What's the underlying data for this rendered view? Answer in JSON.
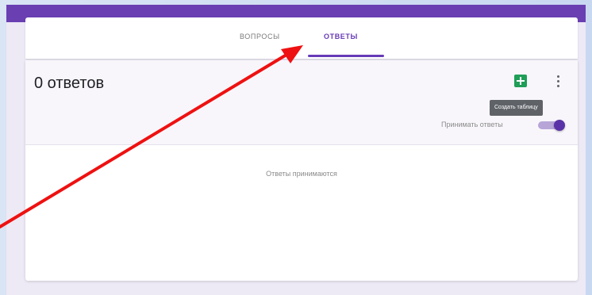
{
  "tabs": {
    "questions": "ВОПРОСЫ",
    "responses": "ОТВЕТЫ",
    "active": "responses"
  },
  "summary": {
    "count_label": "0 ответов"
  },
  "actions": {
    "sheets_icon": "sheets-icon",
    "more_icon": "more-vert-icon",
    "tooltip": "Создать таблицу"
  },
  "accept_toggle": {
    "label": "Принимать ответы",
    "on": true
  },
  "status": {
    "message": "Ответы принимаются"
  },
  "colors": {
    "accent": "#673ab7",
    "sheets": "#1e9e57",
    "annotation_arrow": "#ee1111"
  }
}
